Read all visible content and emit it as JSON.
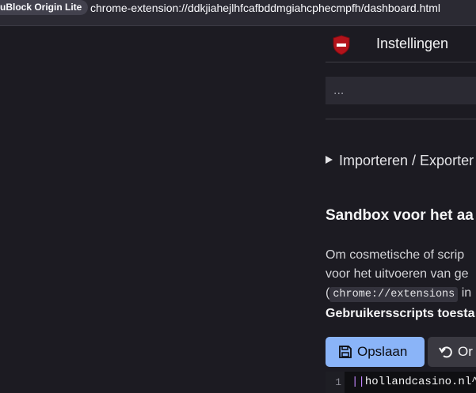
{
  "browser": {
    "extension_label": "uBlock Origin Lite",
    "url": "chrome-extension://ddkjiahejlhfcafbddmgiahcphecmpfh/dashboard.html"
  },
  "header": {
    "icon": "ublock-shield-icon",
    "title": "Instellingen"
  },
  "search": {
    "value": "..."
  },
  "import_export": {
    "label": "Importeren / Exporter"
  },
  "sandbox": {
    "title": "Sandbox voor het aa",
    "line1": "Om cosmetische of scrip",
    "line2": "voor het uitvoeren van ge",
    "line3_prefix": "(",
    "line3_code": "chrome://extensions",
    "line3_suffix": " in",
    "line4_bold": "Gebruikersscripts toesta"
  },
  "toolbar": {
    "save_label": "Opslaan",
    "second_label": "Or"
  },
  "editor": {
    "line_number": "1",
    "pipes": "||",
    "text": "hollandcasino.nl^"
  },
  "colors": {
    "accent": "#8ab4f8",
    "shield": "#b3131b",
    "background": "#1c1b22"
  }
}
